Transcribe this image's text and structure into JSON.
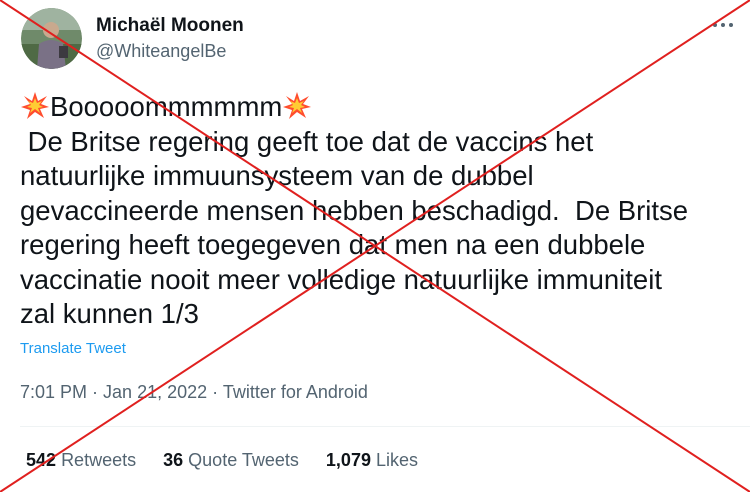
{
  "author": {
    "name": "Michaël Moonen",
    "handle": "@WhiteangelBe"
  },
  "tweet": {
    "first_line": "Booooommmmmm",
    "lines": [
      " De Britse regering geeft toe dat de vaccins het",
      "natuurlijke immuunsysteem van de dubbel",
      "gevaccineerde mensen hebben beschadigd.  De Britse",
      "regering heeft toegegeven dat men na een dubbele",
      "vaccinatie nooit meer volledige natuurlijke immuniteit",
      "zal kunnen 1/3"
    ],
    "translate_label": "Translate Tweet"
  },
  "meta": {
    "time": "7:01 PM",
    "separator": " · ",
    "date": "Jan 21, 2022",
    "source": "Twitter for Android"
  },
  "stats": {
    "retweets_count": "542",
    "retweets_label": "Retweets",
    "quotes_count": "36",
    "quotes_label": "Quote Tweets",
    "likes_count": "1,079",
    "likes_label": "Likes"
  },
  "icons": {
    "more": "more-options-icon",
    "emoji": "collision-emoji-icon",
    "overlay": "red-cross-overlay"
  },
  "colors": {
    "text": "#0f1419",
    "secondary": "#536471",
    "link": "#1d9bf0",
    "overlay": "#e0201f"
  }
}
